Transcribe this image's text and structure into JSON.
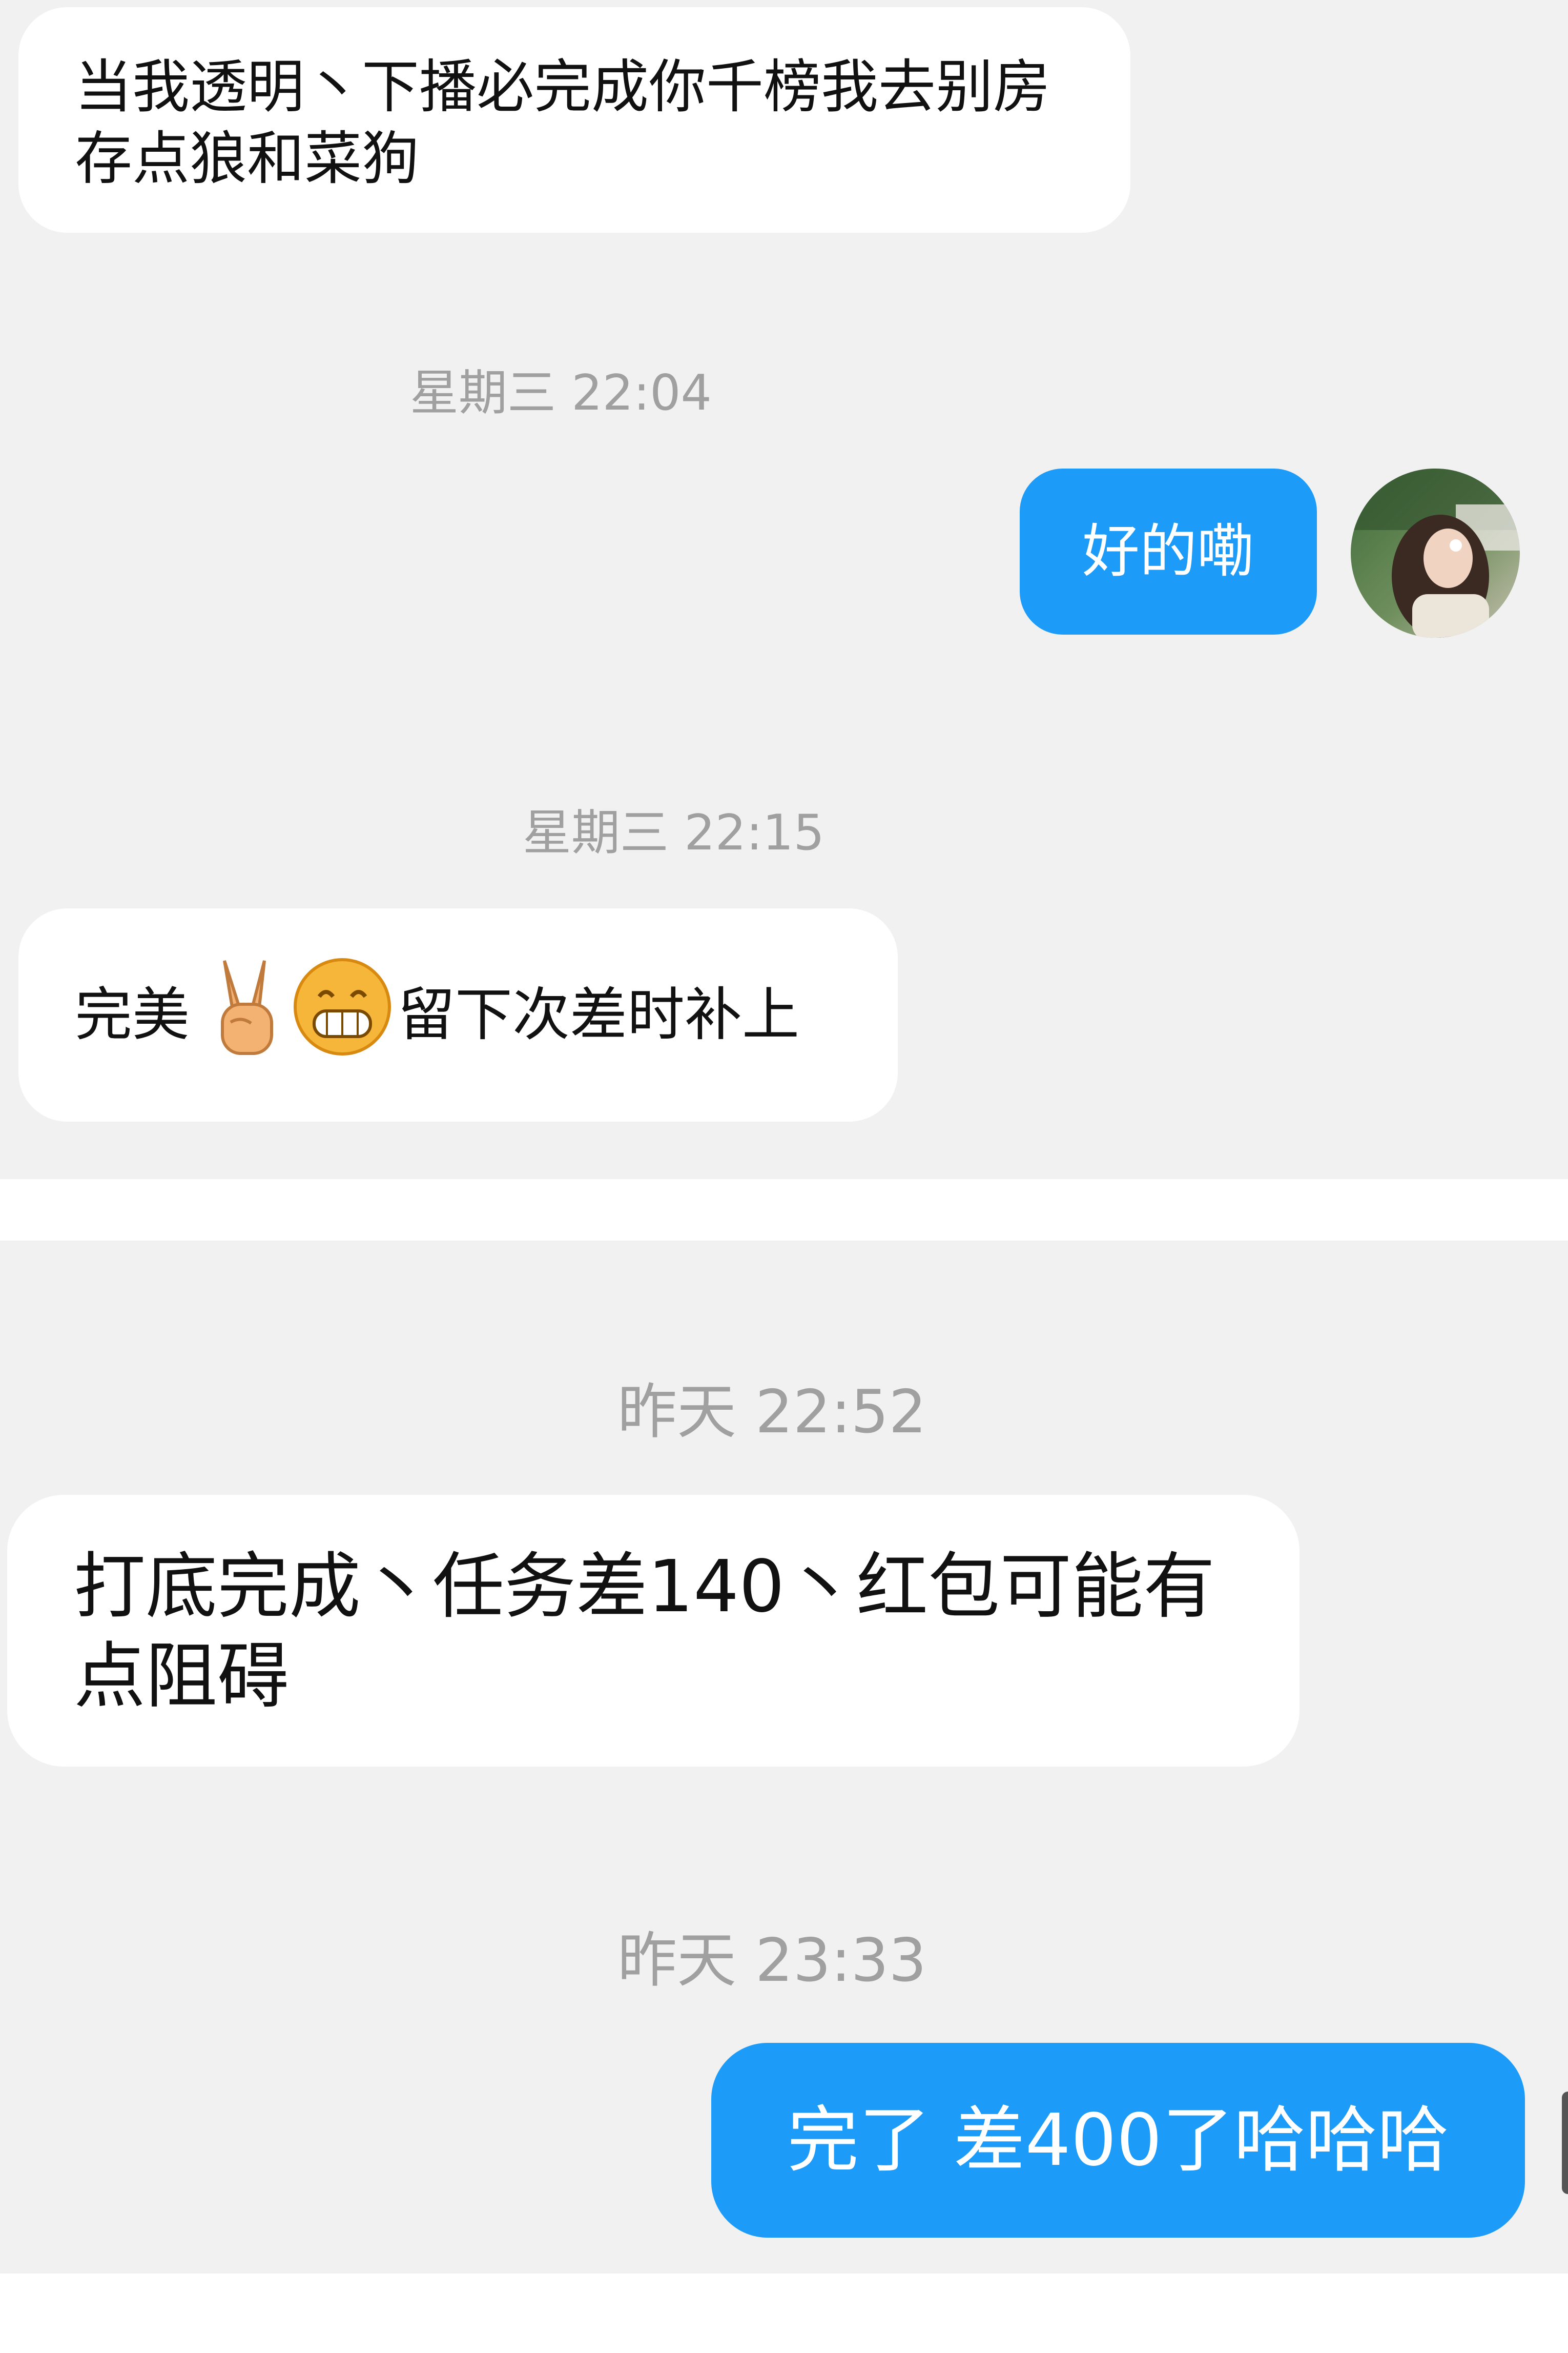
{
  "panel1": {
    "msg1": {
      "text": "当我透明丶下播必完成你千榜我去别房存点狼和菜狗",
      "sender": "other"
    },
    "time1": "星期三 22:04",
    "msg2": {
      "text": "好的嘞",
      "sender": "self"
    },
    "time2": "星期三 22:15",
    "msg3": {
      "text_before": "完美",
      "emoji1": "victory-hand-icon",
      "emoji2": "grinning-face-icon",
      "text_after": "留下次差时补上",
      "sender": "other"
    }
  },
  "panel2": {
    "time1": "昨天 22:52",
    "msg1": {
      "text": "打底完成丶任务差140丶红包可能有点阻碍",
      "sender": "other"
    },
    "time2": "昨天 23:33",
    "msg2": {
      "text": "完了 差400了哈哈哈",
      "sender": "self"
    }
  },
  "colors": {
    "background": "#f1f1f1",
    "incoming_bubble": "#ffffff",
    "outgoing_bubble": "#1c9bf8",
    "timestamp_text": "#a0a0a0",
    "message_text": "#111111"
  }
}
